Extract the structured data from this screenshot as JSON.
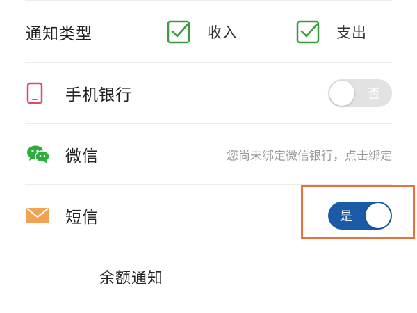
{
  "notify_type": {
    "label": "通知类型",
    "options": [
      {
        "label": "收入",
        "checked": true
      },
      {
        "label": "支出",
        "checked": true
      }
    ]
  },
  "channels": {
    "mobile_banking": {
      "label": "手机银行",
      "icon": "phone-icon",
      "toggle_text": "否",
      "enabled": false
    },
    "wechat": {
      "label": "微信",
      "icon": "wechat-icon",
      "hint": "您尚未绑定微信银行，点击绑定"
    },
    "sms": {
      "label": "短信",
      "icon": "envelope-icon",
      "toggle_text": "是",
      "enabled": true
    }
  },
  "balance_notice": {
    "label": "余额通知"
  },
  "colors": {
    "checkbox_green": "#3a9a3e",
    "toggle_on": "#1a5aa7",
    "toggle_off": "#e2e2e2",
    "highlight": "#e8713f",
    "phone_icon": "#d94f6a",
    "wechat_icon": "#2bae3a",
    "envelope_icon": "#f0a352"
  }
}
